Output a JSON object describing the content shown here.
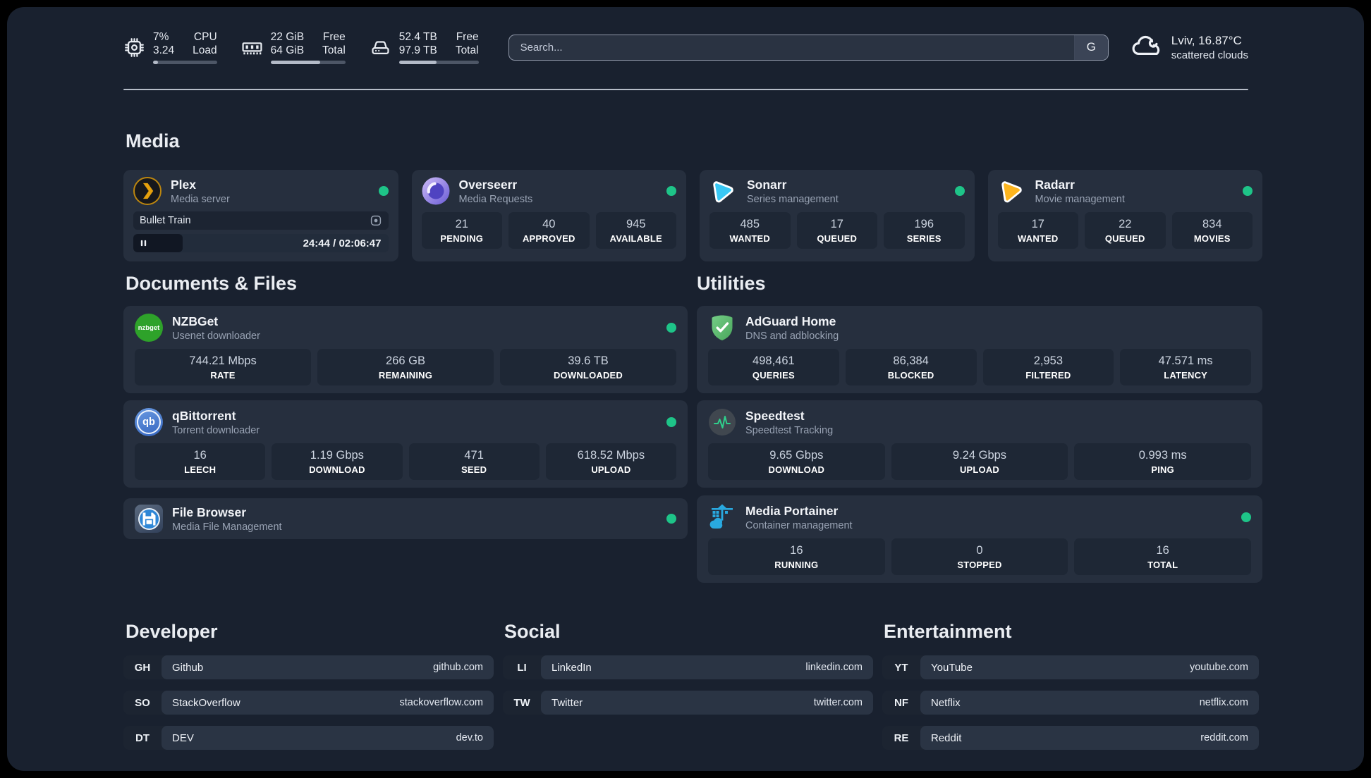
{
  "header": {
    "system_stats": [
      {
        "icon": "cpu-icon",
        "values": [
          "7%",
          "3.24"
        ],
        "labels": [
          "CPU",
          "Load"
        ],
        "progress_pct": 8
      },
      {
        "icon": "ram-icon",
        "values": [
          "22 GiB",
          "64 GiB"
        ],
        "labels": [
          "Free",
          "Total"
        ],
        "progress_pct": 66
      },
      {
        "icon": "disk-icon",
        "values": [
          "52.4 TB",
          "97.9 TB"
        ],
        "labels": [
          "Free",
          "Total"
        ],
        "progress_pct": 47
      }
    ],
    "search_placeholder": "Search...",
    "search_engine_label": "G",
    "weather": {
      "icon": "weather-cloud-icon",
      "line1": "Lviv, 16.87°C",
      "line2": "scattered clouds"
    }
  },
  "sections": [
    {
      "id": "media",
      "title": "Media",
      "apps": [
        {
          "name": "Plex",
          "subtitle": "Media server",
          "icon": "plex-icon",
          "status_dot": true,
          "media_session": {
            "title": "Bullet Train",
            "state": "paused",
            "time_display": "24:44 / 02:06:47",
            "progress_pct": 19.5
          }
        },
        {
          "name": "Overseerr",
          "subtitle": "Media Requests",
          "icon": "overseerr-icon",
          "status_dot": true,
          "stats": [
            {
              "value": "21",
              "label": "PENDING"
            },
            {
              "value": "40",
              "label": "APPROVED"
            },
            {
              "value": "945",
              "label": "AVAILABLE"
            }
          ]
        },
        {
          "name": "Sonarr",
          "subtitle": "Series management",
          "icon": "sonarr-icon",
          "status_dot": true,
          "stats": [
            {
              "value": "485",
              "label": "WANTED"
            },
            {
              "value": "17",
              "label": "QUEUED"
            },
            {
              "value": "196",
              "label": "SERIES"
            }
          ]
        },
        {
          "name": "Radarr",
          "subtitle": "Movie management",
          "icon": "radarr-icon",
          "status_dot": true,
          "stats": [
            {
              "value": "17",
              "label": "WANTED"
            },
            {
              "value": "22",
              "label": "QUEUED"
            },
            {
              "value": "834",
              "label": "MOVIES"
            }
          ]
        }
      ]
    },
    {
      "id": "documents",
      "title": "Documents & Files",
      "apps": [
        {
          "name": "NZBGet",
          "subtitle": "Usenet downloader",
          "icon": "nzbget-icon",
          "status_dot": true,
          "stats": [
            {
              "value": "744.21 Mbps",
              "label": "RATE"
            },
            {
              "value": "266 GB",
              "label": "REMAINING"
            },
            {
              "value": "39.6 TB",
              "label": "DOWNLOADED"
            }
          ]
        },
        {
          "name": "qBittorrent",
          "subtitle": "Torrent downloader",
          "icon": "qbittorrent-icon",
          "status_dot": true,
          "stats": [
            {
              "value": "16",
              "label": "LEECH"
            },
            {
              "value": "1.19 Gbps",
              "label": "DOWNLOAD"
            },
            {
              "value": "471",
              "label": "SEED"
            },
            {
              "value": "618.52 Mbps",
              "label": "UPLOAD"
            }
          ]
        },
        {
          "name": "File Browser",
          "subtitle": "Media File Management",
          "icon": "file-browser-icon",
          "status_dot": true
        }
      ]
    },
    {
      "id": "utilities",
      "title": "Utilities",
      "apps": [
        {
          "name": "AdGuard Home",
          "subtitle": "DNS and adblocking",
          "icon": "adguard-shield-icon",
          "status_dot": false,
          "stats": [
            {
              "value": "498,461",
              "label": "QUERIES"
            },
            {
              "value": "86,384",
              "label": "BLOCKED"
            },
            {
              "value": "2,953",
              "label": "FILTERED"
            },
            {
              "value": "47.571 ms",
              "label": "LATENCY"
            }
          ]
        },
        {
          "name": "Speedtest",
          "subtitle": "Speedtest Tracking",
          "icon": "speedtest-pulse-icon",
          "status_dot": false,
          "stats": [
            {
              "value": "9.65 Gbps",
              "label": "DOWNLOAD"
            },
            {
              "value": "9.24 Gbps",
              "label": "UPLOAD"
            },
            {
              "value": "0.993 ms",
              "label": "PING"
            }
          ]
        },
        {
          "name": "Media Portainer",
          "subtitle": "Container management",
          "icon": "portainer-icon",
          "status_dot": true,
          "stats": [
            {
              "value": "16",
              "label": "RUNNING"
            },
            {
              "value": "0",
              "label": "STOPPED"
            },
            {
              "value": "16",
              "label": "TOTAL"
            }
          ]
        }
      ]
    }
  ],
  "link_groups": [
    {
      "id": "developer",
      "title": "Developer",
      "links": [
        {
          "abbr": "GH",
          "name": "Github",
          "url": "github.com"
        },
        {
          "abbr": "SO",
          "name": "StackOverflow",
          "url": "stackoverflow.com"
        },
        {
          "abbr": "DT",
          "name": "DEV",
          "url": "dev.to"
        }
      ]
    },
    {
      "id": "social",
      "title": "Social",
      "links": [
        {
          "abbr": "LI",
          "name": "LinkedIn",
          "url": "linkedin.com"
        },
        {
          "abbr": "TW",
          "name": "Twitter",
          "url": "twitter.com"
        }
      ]
    },
    {
      "id": "entertainment",
      "title": "Entertainment",
      "links": [
        {
          "abbr": "YT",
          "name": "YouTube",
          "url": "youtube.com"
        },
        {
          "abbr": "NF",
          "name": "Netflix",
          "url": "netflix.com"
        },
        {
          "abbr": "RE",
          "name": "Reddit",
          "url": "reddit.com"
        }
      ]
    }
  ],
  "colors": {
    "background": "#19212f",
    "card": "#262f3e",
    "stat_box": "#1e2735",
    "online_dot": "#1ec488",
    "accent_plex": "#e5a00d",
    "accent_sonarr": "#38c8f5",
    "accent_radarr": "#fdb51e",
    "accent_speedtest": "#2fd08c",
    "accent_portainer": "#29a9e0",
    "accent_adguard": "#5cbb6e"
  }
}
